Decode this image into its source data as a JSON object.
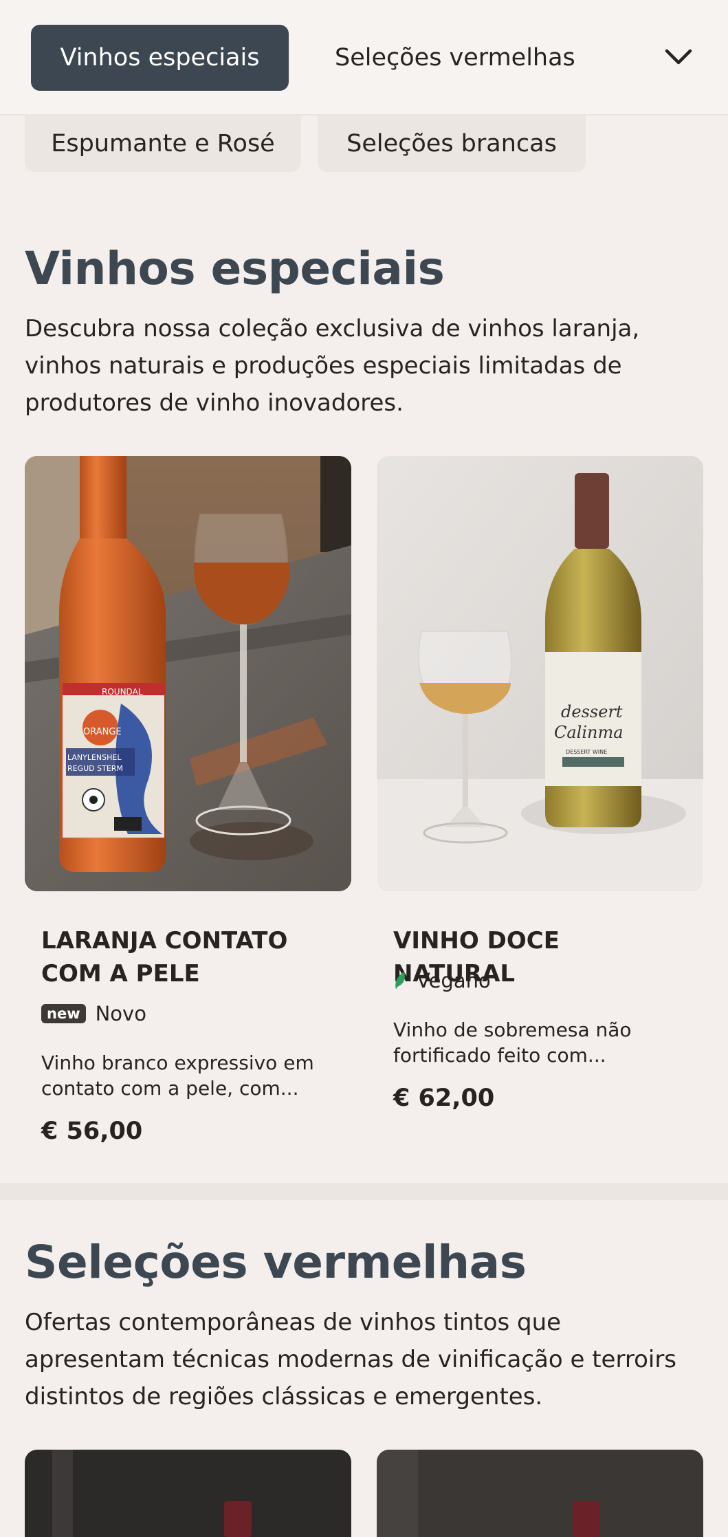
{
  "nav": {
    "active_tab": "Vinhos especiais",
    "second_tab": "Seleções vermelhas",
    "chips": [
      "Espumante e Rosé",
      "Seleções brancas"
    ]
  },
  "section1": {
    "title": "Vinhos especiais",
    "description": "Descubra nossa coleção exclusiva de vinhos laranja, vinhos naturais e produções especiais limitadas de produtores de vinho inovadores.",
    "products": [
      {
        "title": "LARANJA CONTATO COM A PELE",
        "badge": "new",
        "badge_label": "Novo",
        "description": "Vinho branco expressivo em contato com a pele, com...",
        "price": "€ 56,00"
      },
      {
        "title": "VINHO DOCE NATURAL",
        "badge_icon": "leaf-icon",
        "badge_label": "Vegano",
        "description": "Vinho de sobremesa não fortificado feito com...",
        "price": "€ 62,00"
      }
    ]
  },
  "section2": {
    "title": "Seleções vermelhas",
    "description": "Ofertas contemporâneas de vinhos tintos que apresentam técnicas modernas de vinificação e terroirs distintos de regiões clássicas e emergentes."
  },
  "label_texts": {
    "orange_bottle": [
      "ROUNDAL",
      "ORANGE",
      "LANYLENSHEL",
      "REGUD STERM"
    ],
    "dessert_bottle": [
      "dessert",
      "Calinma",
      "DESSERT WINE"
    ]
  },
  "colors": {
    "background": "#f4efec",
    "nav_active": "#3d4752",
    "heading": "#3d4752",
    "leaf": "#2e9e5b"
  }
}
